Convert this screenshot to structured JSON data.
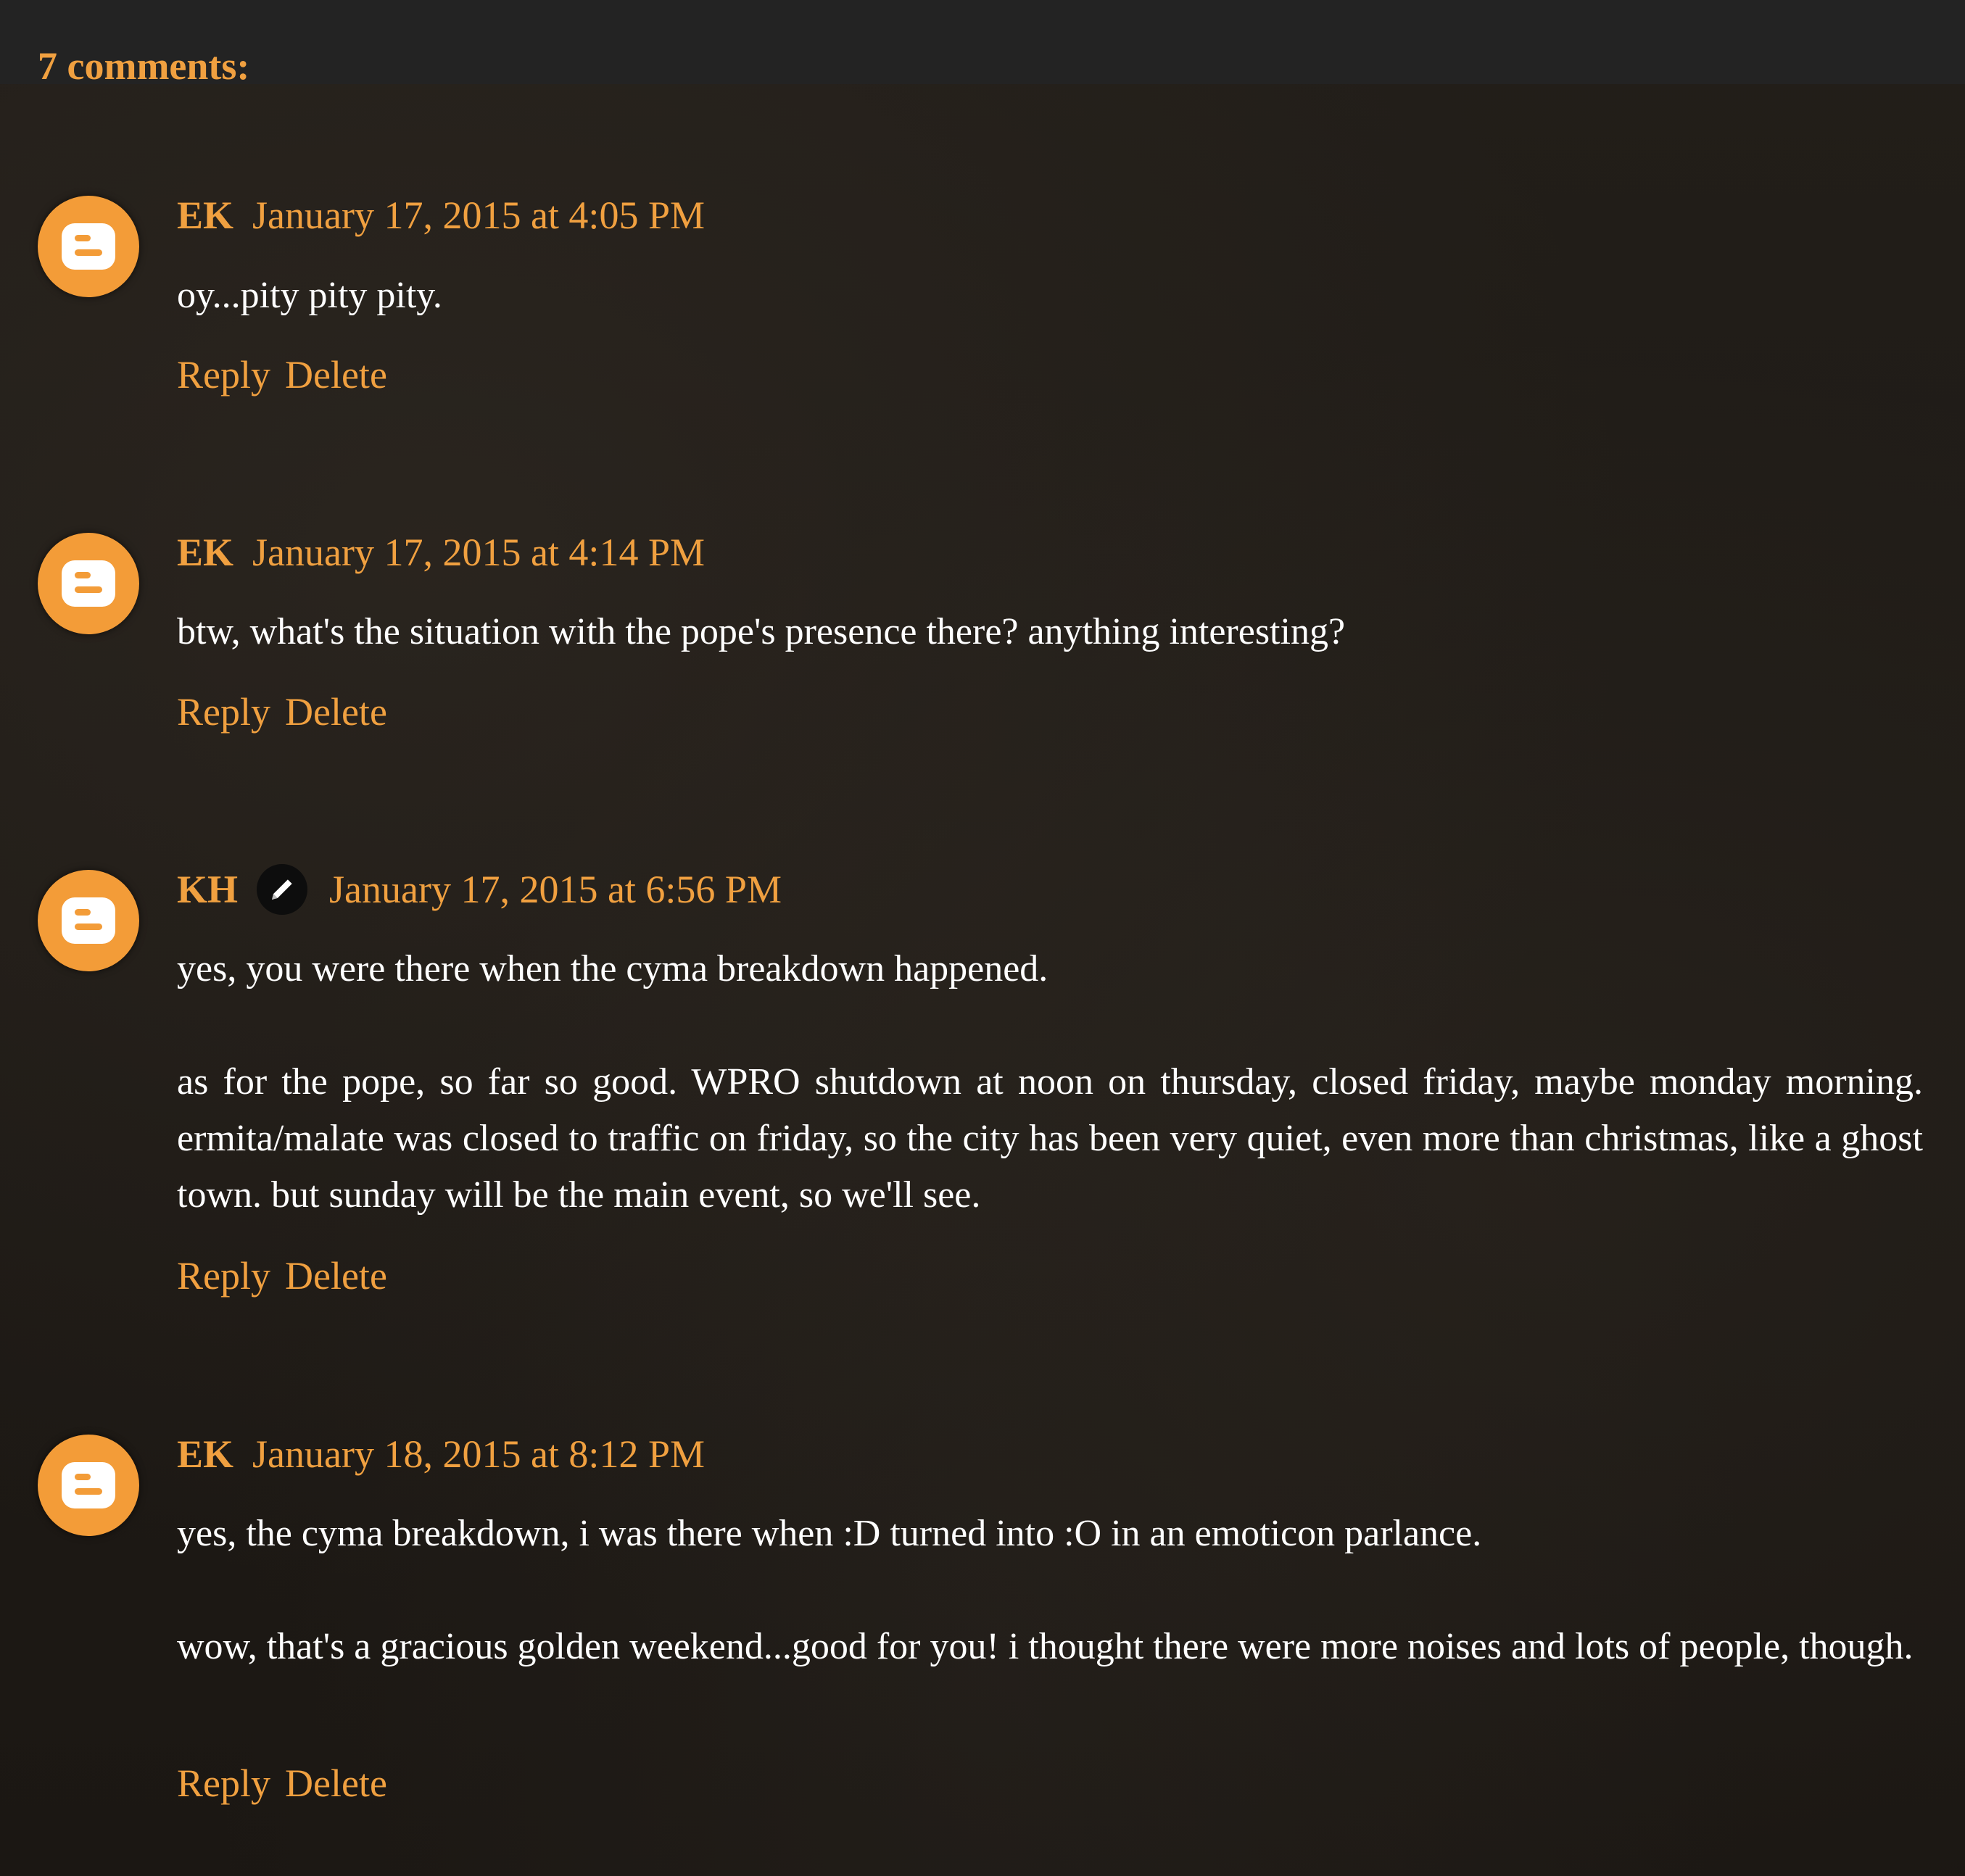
{
  "comments_header": "7 comments:",
  "comments": [
    {
      "author": "EK",
      "timestamp": "January 17, 2015 at 4:05 PM",
      "paragraphs": [
        "oy...pity pity pity."
      ],
      "reply_label": "Reply",
      "delete_label": "Delete",
      "avatar_icon": "blogger-icon"
    },
    {
      "author": "EK",
      "timestamp": "January 17, 2015 at 4:14 PM",
      "paragraphs": [
        "btw, what's the situation with the pope's presence there? anything interesting?"
      ],
      "reply_label": "Reply",
      "delete_label": "Delete",
      "avatar_icon": "blogger-icon"
    },
    {
      "author": "KH",
      "author_badge_icon": "pencil-icon",
      "timestamp": "January 17, 2015 at 6:56 PM",
      "paragraphs": [
        "yes, you were there when the cyma breakdown happened.",
        "as for the pope, so far so good. WPRO shutdown at noon on thursday, closed friday, maybe monday morning. ermita/malate was closed to traffic on friday, so the city has been very quiet, even more than christmas, like a ghost town. but sunday will be the main event, so we'll see."
      ],
      "reply_label": "Reply",
      "delete_label": "Delete",
      "avatar_icon": "blogger-icon"
    },
    {
      "author": "EK",
      "timestamp": "January 18, 2015 at 8:12 PM",
      "paragraphs": [
        "yes, the cyma breakdown, i was there when :D turned into :O in an emoticon parlance.",
        "wow, that's a gracious golden weekend...good for you! i thought there were more noises and lots of people, though."
      ],
      "reply_label": "Reply",
      "delete_label": "Delete",
      "avatar_icon": "blogger-icon"
    }
  ],
  "colors": {
    "accent": "#f0a040",
    "avatar": "#f39c38",
    "background": "#1d1915",
    "top_bar": "#232323",
    "text": "#ffffff"
  }
}
